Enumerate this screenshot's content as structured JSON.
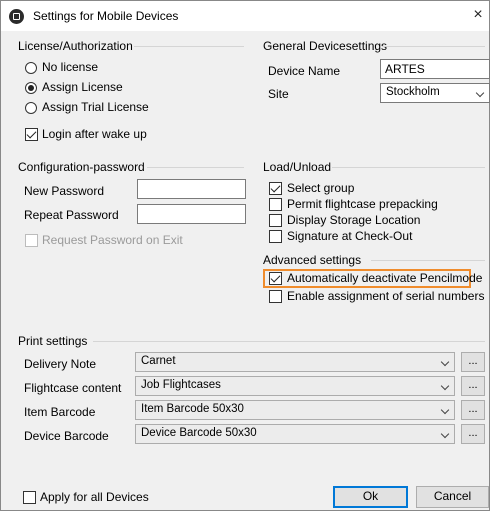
{
  "window": {
    "title": "Settings for Mobile Devices",
    "close_glyph": "×"
  },
  "license": {
    "legend": "License/Authorization",
    "options": [
      "No license",
      "Assign License",
      "Assign Trial License"
    ],
    "selected": "Assign License",
    "login_after_wake": {
      "label": "Login after wake up",
      "checked": true
    }
  },
  "general": {
    "legend": "General Devicesettings",
    "device_name_label": "Device Name",
    "device_name_value": "ARTES",
    "site_label": "Site",
    "site_value": "Stockholm"
  },
  "config_password": {
    "legend": "Configuration-password",
    "new_password_label": "New Password",
    "new_password_value": "",
    "repeat_password_label": "Repeat Password",
    "repeat_password_value": "",
    "request_on_exit": {
      "label": "Request Password on Exit",
      "checked": false,
      "disabled": true
    }
  },
  "load_unload": {
    "legend": "Load/Unload",
    "items": [
      {
        "label": "Select group",
        "checked": true
      },
      {
        "label": "Permit flightcase prepacking",
        "checked": false
      },
      {
        "label": "Display Storage Location",
        "checked": false
      },
      {
        "label": "Signature at Check-Out",
        "checked": false
      }
    ]
  },
  "advanced": {
    "legend": "Advanced settings",
    "items": [
      {
        "label": "Automatically deactivate Pencilmode",
        "checked": true,
        "highlighted": true
      },
      {
        "label": "Enable assignment of serial numbers",
        "checked": false
      }
    ]
  },
  "print": {
    "legend": "Print settings",
    "rows": [
      {
        "label": "Delivery Note",
        "value": "Carnet"
      },
      {
        "label": "Flightcase content",
        "value": "Job Flightcases"
      },
      {
        "label": "Item Barcode",
        "value": "Item Barcode 50x30"
      },
      {
        "label": "Device Barcode",
        "value": "Device Barcode 50x30"
      }
    ],
    "browse_label": "..."
  },
  "footer": {
    "apply_all": {
      "label": "Apply for all Devices",
      "checked": false
    },
    "ok_label": "Ok",
    "cancel_label": "Cancel"
  },
  "colors": {
    "highlight": "#f08c2c",
    "default_button_border": "#0078d7"
  },
  "icons": [
    "app-icon",
    "close-icon",
    "chevron-down-icon"
  ]
}
